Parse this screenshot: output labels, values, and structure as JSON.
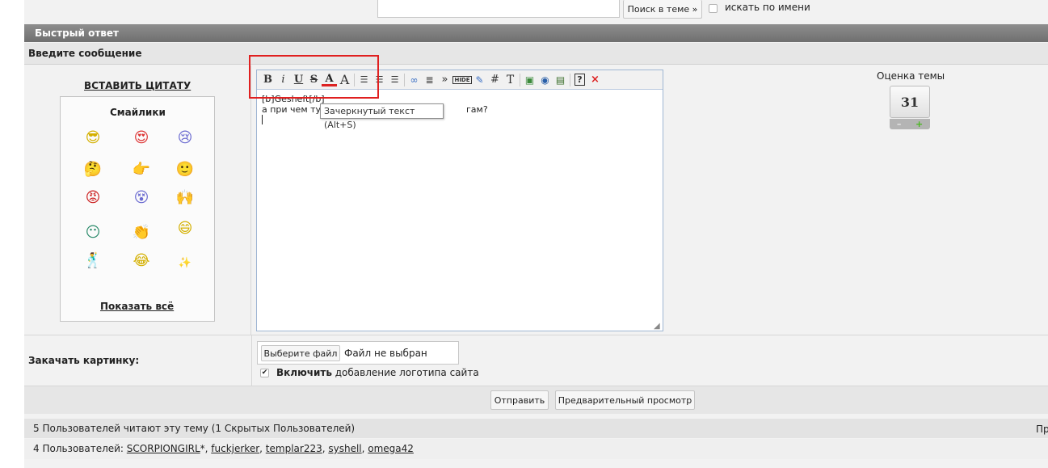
{
  "search": {
    "button_label": "Поиск в теме »",
    "checkbox_label": "искать по имени"
  },
  "quick_reply": {
    "title": "Быстрый ответ",
    "subtitle": "Введите сообщение"
  },
  "left_panel": {
    "insert_quote": "ВСТАВИТЬ ЦИТАТУ",
    "smilies_title": "Смайлики",
    "show_all": "Показать всё",
    "smilies": [
      "cool-smiley",
      "love-smiley",
      "crying-smiley",
      "thinking-smiley",
      "pointing-smiley",
      "green-smiley",
      "shooting-smiley",
      "dizzy-smiley",
      "cheering-smiley",
      "teal-smiley",
      "clapping-smiley",
      "cheerleader-smiley",
      "dancing-smiley",
      "laughing-smiley",
      "star-smiley"
    ]
  },
  "toolbar": {
    "bold": "B",
    "italic": "i",
    "underline": "U",
    "strike": "S",
    "color": "A",
    "size": "A",
    "hide": "HIDE",
    "hash": "#",
    "font": "T",
    "quote": "»",
    "close": "×",
    "help": "?"
  },
  "editor": {
    "line1": "[b]Gesheft[/b]",
    "line2_start": "а при чем ту",
    "line2_end": "гам?"
  },
  "tooltip": "Зачеркнутый текст (Alt+S)",
  "rating": {
    "label": "Оценка темы",
    "value": "31",
    "minus": "–",
    "plus": "+"
  },
  "upload": {
    "label": "Закачать картинку:",
    "choose_button": "Выберите файл",
    "no_file": "Файл не выбран",
    "logo_bold": "Включить",
    "logo_rest": " добавление логотипа сайта"
  },
  "actions": {
    "send": "Отправить",
    "preview": "Предварительный просмотр"
  },
  "readers": {
    "summary": "5 Пользователей читают эту тему (1 Скрытых Пользователей)",
    "right_fragment": "Пр",
    "users_prefix": "4 Пользователей: ",
    "users": [
      "SCORPIONGIRL",
      "fuckjerker",
      "templar223",
      "syshell",
      "omega42"
    ],
    "first_user_suffix": "*"
  },
  "colors": {
    "title_bar": "#7d7d7d",
    "editor_border": "#9fb6d3",
    "highlight": "#e02020"
  }
}
